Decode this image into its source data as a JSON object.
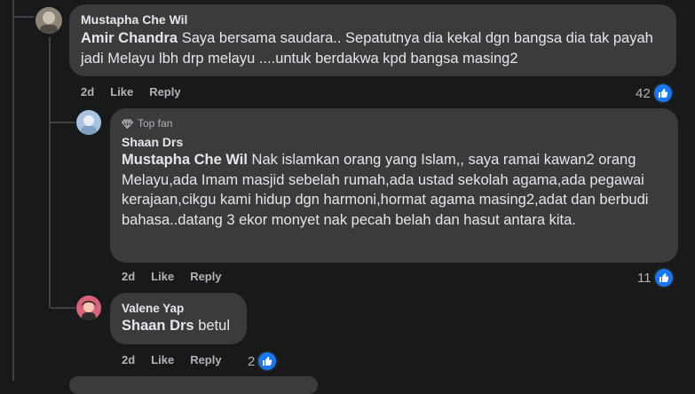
{
  "comments": [
    {
      "author": "Mustapha Che Wil",
      "mention": "Amir Chandra",
      "text": " Saya bersama saudara.. Sepatutnya dia kekal dgn bangsa dia tak payah jadi Melayu lbh drp melayu ....untuk berdakwa kpd bangsa masing2",
      "time": "2d",
      "like_label": "Like",
      "reply_label": "Reply",
      "reaction_count": "42",
      "reaction_icon": "like-icon"
    },
    {
      "badge": "Top fan",
      "badge_icon": "diamond-icon",
      "author": "Shaan Drs",
      "mention": "Mustapha Che Wil",
      "text": " Nak islamkan orang yang Islam,, saya ramai kawan2 orang Melayu,ada Imam masjid sebelah rumah,ada ustad sekolah agama,ada pegawai kerajaan,cikgu kami hidup dgn harmoni,hormat agama masing2,adat dan berbudi bahasa..datang 3 ekor monyet nak pecah belah dan hasut antara kita.",
      "time": "2d",
      "like_label": "Like",
      "reply_label": "Reply",
      "reaction_count": "11",
      "reaction_icon": "like-icon"
    },
    {
      "author": "Valene Yap",
      "mention": "Shaan Drs",
      "text": " betul",
      "time": "2d",
      "like_label": "Like",
      "reply_label": "Reply",
      "reaction_count": "2",
      "reaction_icon": "like-icon"
    }
  ],
  "colors": {
    "background": "#18191a",
    "bubble": "#3a3b3c",
    "like_blue": "#1877f2",
    "muted_text": "#b0b3b8"
  }
}
